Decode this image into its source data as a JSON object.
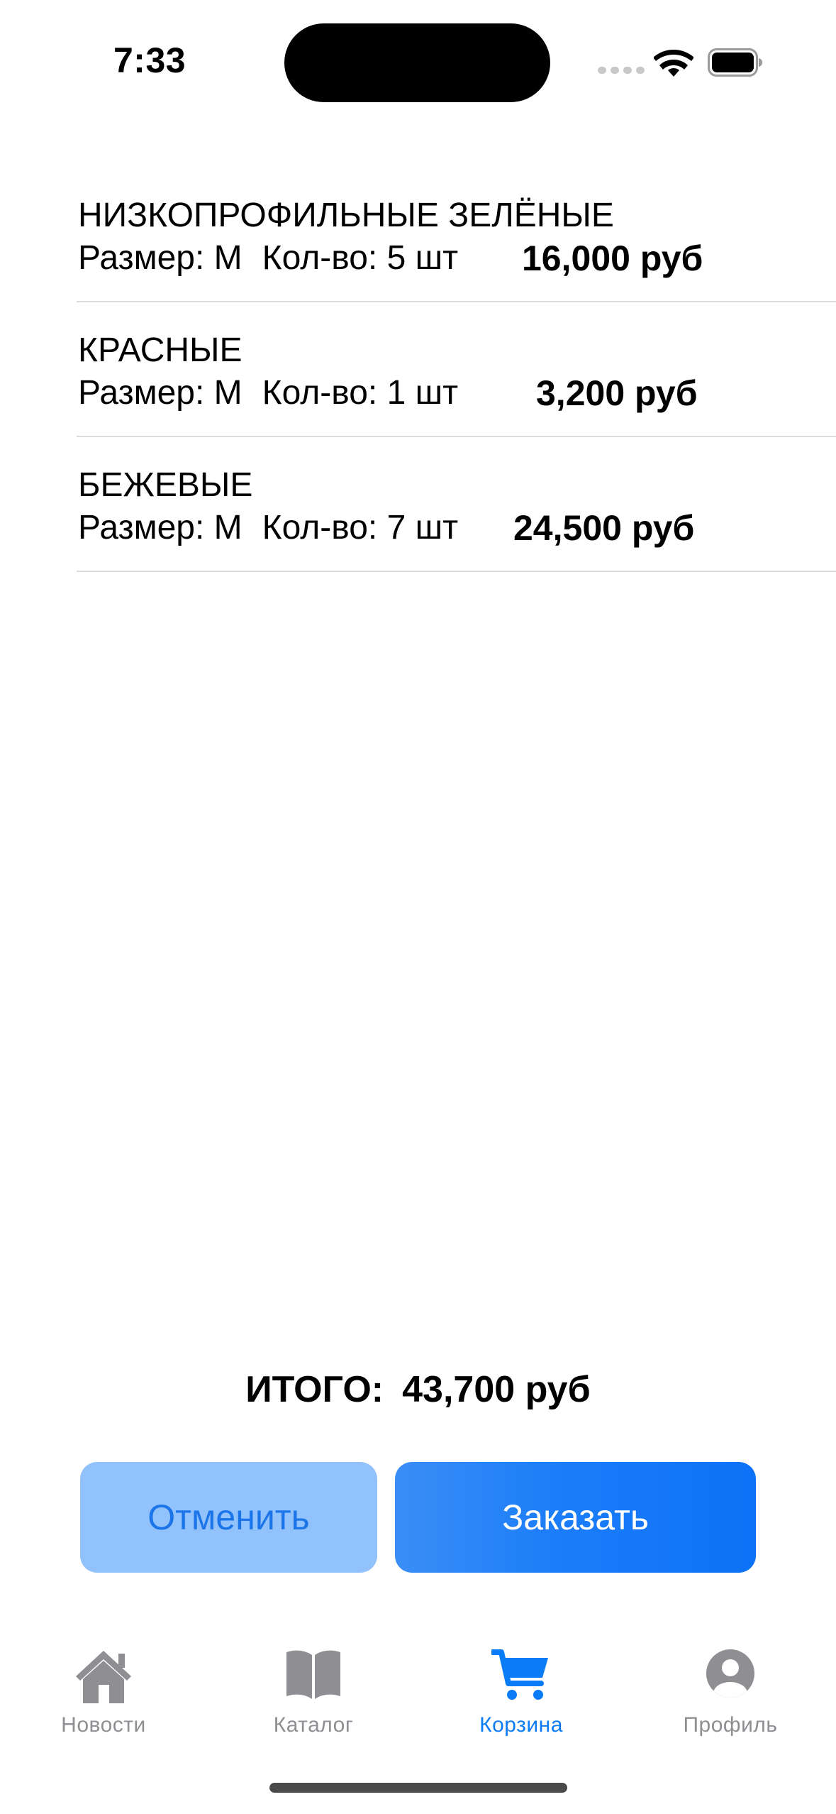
{
  "status_bar": {
    "time": "7:33"
  },
  "cart": {
    "items": [
      {
        "title": "НИЗКОПРОФИЛЬНЫЕ ЗЕЛЁНЫЕ",
        "size": "Размер: M",
        "quantity": "Кол-во: 5 шт",
        "price": "16,000 руб"
      },
      {
        "title": "КРАСНЫЕ",
        "size": "Размер: M",
        "quantity": "Кол-во: 1 шт",
        "price": "3,200 руб"
      },
      {
        "title": "БЕЖЕВЫЕ",
        "size": "Размер: M",
        "quantity": "Кол-во: 7 шт",
        "price": "24,500 руб"
      }
    ],
    "total_label": "ИТОГО:",
    "total_value": "43,700 руб"
  },
  "actions": {
    "cancel_label": "Отменить",
    "order_label": "Заказать"
  },
  "tabbar": {
    "tabs": [
      {
        "label": "Новости",
        "icon": "house-icon",
        "active": false
      },
      {
        "label": "Каталог",
        "icon": "book-icon",
        "active": false
      },
      {
        "label": "Корзина",
        "icon": "cart-icon",
        "active": true
      },
      {
        "label": "Профиль",
        "icon": "person-circle-icon",
        "active": false
      }
    ]
  },
  "colors": {
    "accent": "#0a7cf6",
    "cancel_button_bg": "#91c2fb",
    "inactive_tab": "#8e8e93",
    "separator": "#dcdcde"
  }
}
